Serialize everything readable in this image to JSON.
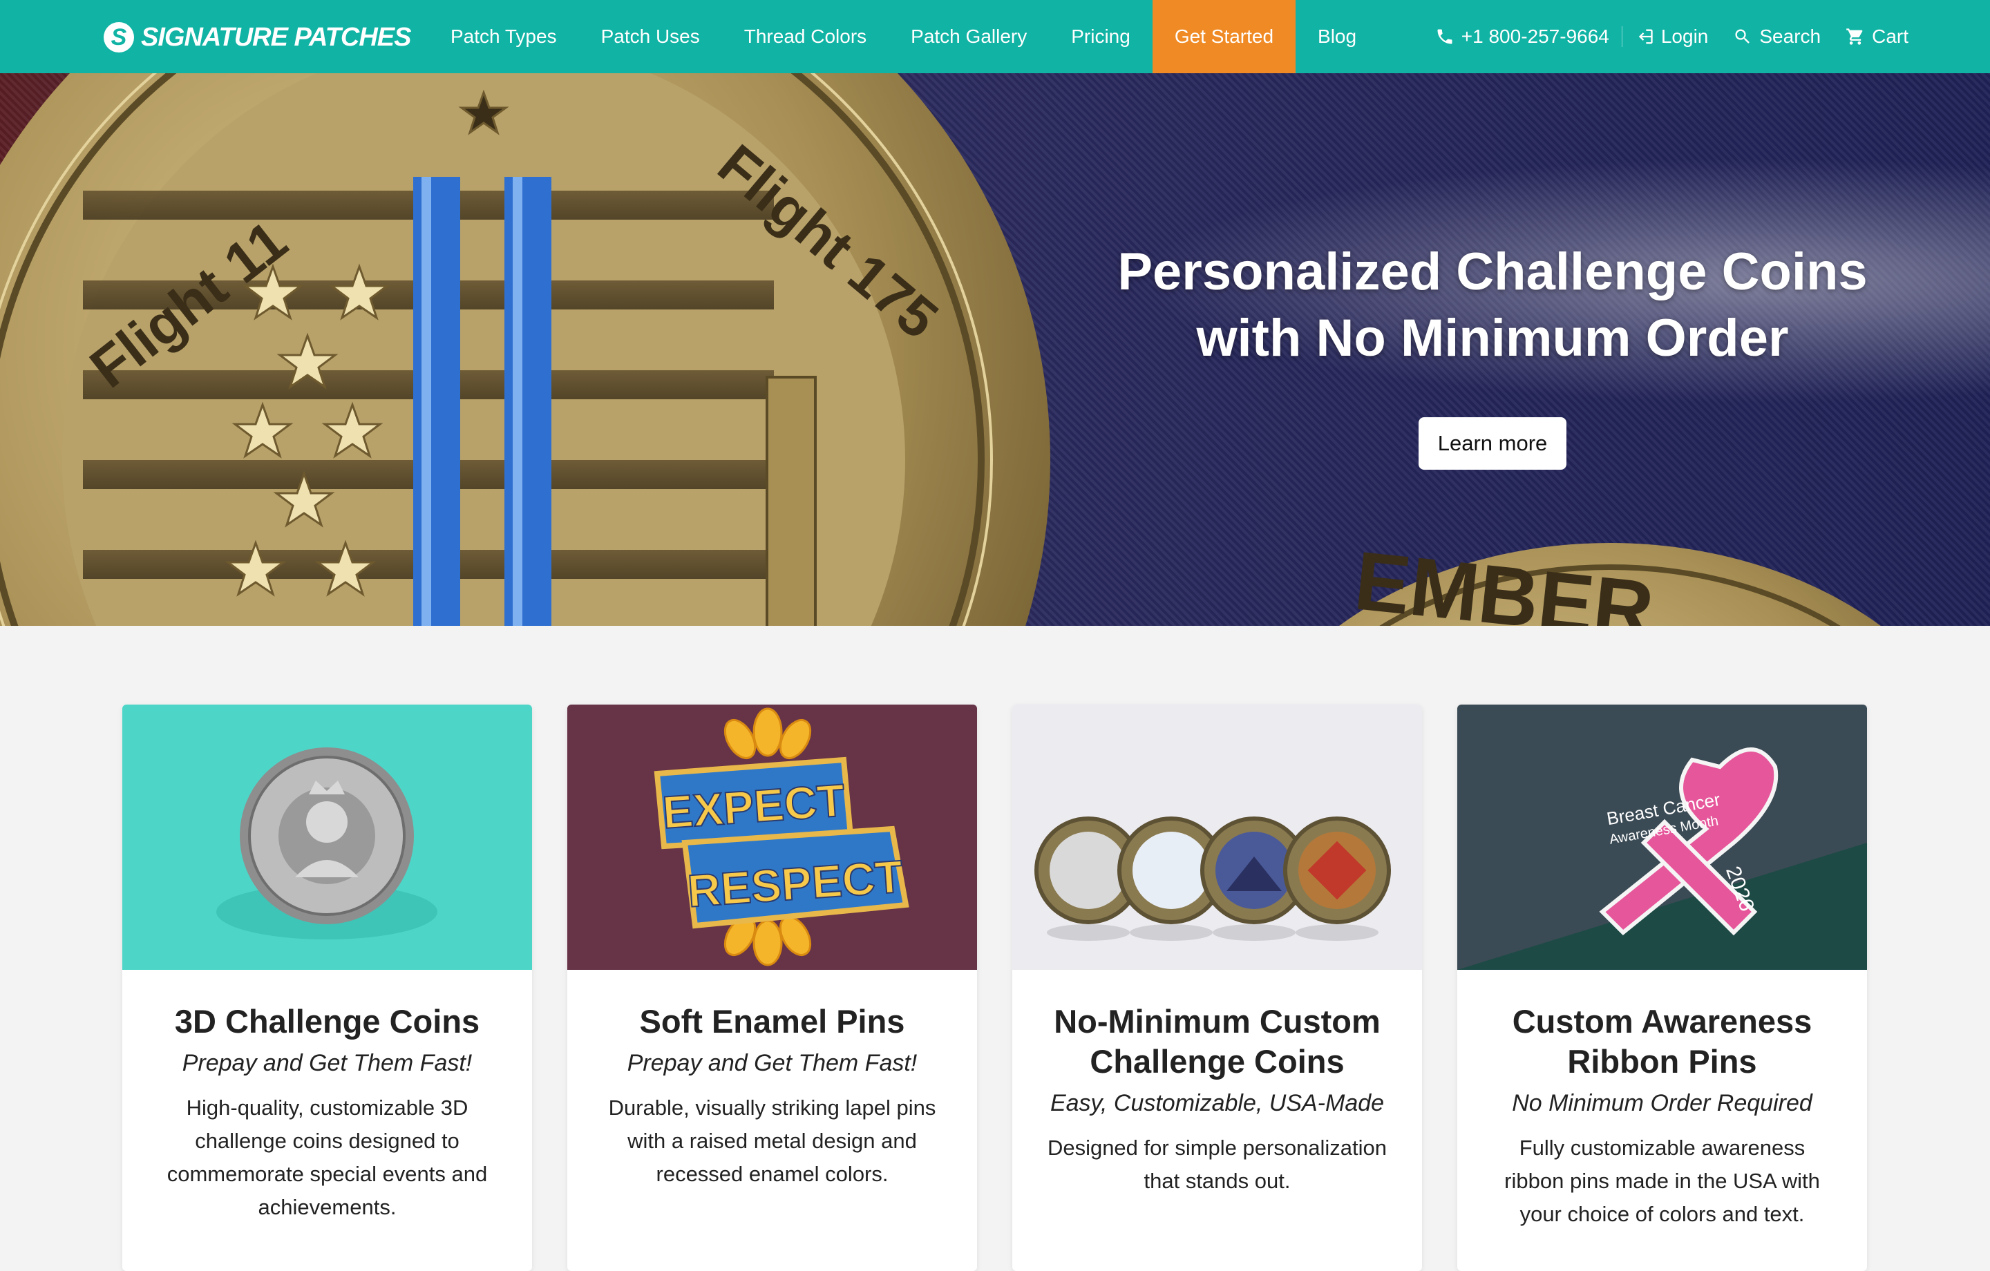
{
  "brand": {
    "name": "SIGNATURE PATCHES",
    "logo_letter": "S",
    "primary": "#10b3a4",
    "accent": "#f08a24"
  },
  "nav": {
    "links": [
      {
        "label": "Patch Types"
      },
      {
        "label": "Patch Uses"
      },
      {
        "label": "Thread Colors"
      },
      {
        "label": "Patch Gallery"
      },
      {
        "label": "Pricing"
      },
      {
        "label": "Get Started",
        "active": true
      },
      {
        "label": "Blog"
      }
    ],
    "phone": "+1 800-257-9664",
    "login": "Login",
    "search": "Search",
    "cart": "Cart"
  },
  "hero": {
    "title_line1": "Personalized Challenge Coins",
    "title_line2": "with No Minimum Order",
    "button": "Learn more",
    "coin_text_left": "Flight 11",
    "coin_text_right": "Flight 175",
    "coin2_text": "EMBER"
  },
  "cards": [
    {
      "title": "3D Challenge Coins",
      "subtitle": "Prepay and Get Them Fast!",
      "description": "High-quality, customizable 3D challenge coins designed to commemorate special events and achievements."
    },
    {
      "title": "Soft Enamel Pins",
      "subtitle": "Prepay and Get Them Fast!",
      "description": "Durable, visually striking lapel pins with a raised metal design and recessed enamel colors.",
      "pin_line1": "EXPECT",
      "pin_line2": "RESPECT"
    },
    {
      "title": "No-Minimum Custom Challenge Coins",
      "subtitle": "Easy, Customizable, USA-Made",
      "description": "Designed for simple personalization that stands out."
    },
    {
      "title": "Custom Awareness Ribbon Pins",
      "subtitle": "No Minimum Order Required",
      "description": "Fully customizable awareness ribbon pins made in the USA with your choice of colors and text.",
      "ribbon_line1": "Breast Cancer",
      "ribbon_line2": "Awareness Month",
      "ribbon_year": "2026"
    }
  ]
}
